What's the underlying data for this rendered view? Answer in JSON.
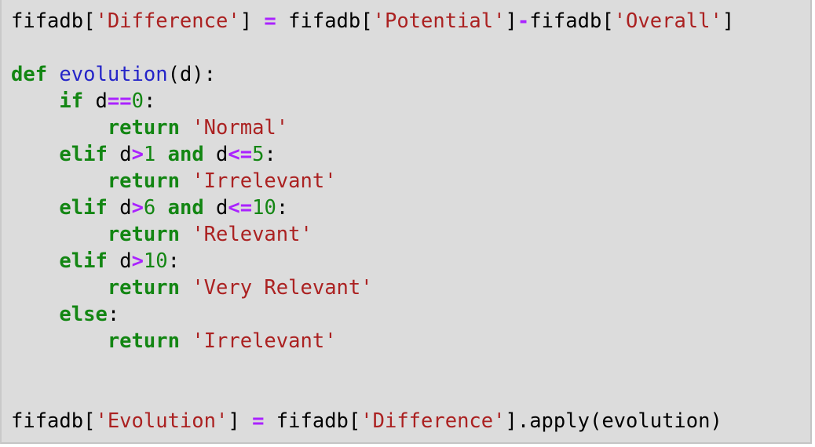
{
  "cell": {
    "lines": [
      {
        "tokens": [
          {
            "t": "fifadb[",
            "c": "pl"
          },
          {
            "t": "'Difference'",
            "c": "str"
          },
          {
            "t": "] ",
            "c": "pl"
          },
          {
            "t": "=",
            "c": "op"
          },
          {
            "t": " fifadb[",
            "c": "pl"
          },
          {
            "t": "'Potential'",
            "c": "str"
          },
          {
            "t": "]",
            "c": "pl"
          },
          {
            "t": "-",
            "c": "op"
          },
          {
            "t": "fifadb[",
            "c": "pl"
          },
          {
            "t": "'Overall'",
            "c": "str"
          },
          {
            "t": "]",
            "c": "pl"
          }
        ]
      },
      {
        "tokens": []
      },
      {
        "tokens": [
          {
            "t": "def",
            "c": "kw"
          },
          {
            "t": " ",
            "c": "pl"
          },
          {
            "t": "evolution",
            "c": "fn"
          },
          {
            "t": "(d):",
            "c": "pl"
          }
        ]
      },
      {
        "tokens": [
          {
            "t": "    ",
            "c": "pl"
          },
          {
            "t": "if",
            "c": "kw"
          },
          {
            "t": " d",
            "c": "pl"
          },
          {
            "t": "==",
            "c": "op"
          },
          {
            "t": "0",
            "c": "num"
          },
          {
            "t": ":",
            "c": "pl"
          }
        ]
      },
      {
        "tokens": [
          {
            "t": "        ",
            "c": "pl"
          },
          {
            "t": "return",
            "c": "kw"
          },
          {
            "t": " ",
            "c": "pl"
          },
          {
            "t": "'Normal'",
            "c": "str"
          }
        ]
      },
      {
        "tokens": [
          {
            "t": "    ",
            "c": "pl"
          },
          {
            "t": "elif",
            "c": "kw"
          },
          {
            "t": " d",
            "c": "pl"
          },
          {
            "t": ">",
            "c": "op"
          },
          {
            "t": "1",
            "c": "num"
          },
          {
            "t": " ",
            "c": "pl"
          },
          {
            "t": "and",
            "c": "kw"
          },
          {
            "t": " d",
            "c": "pl"
          },
          {
            "t": "<=",
            "c": "op"
          },
          {
            "t": "5",
            "c": "num"
          },
          {
            "t": ":",
            "c": "pl"
          }
        ]
      },
      {
        "tokens": [
          {
            "t": "        ",
            "c": "pl"
          },
          {
            "t": "return",
            "c": "kw"
          },
          {
            "t": " ",
            "c": "pl"
          },
          {
            "t": "'Irrelevant'",
            "c": "str"
          }
        ]
      },
      {
        "tokens": [
          {
            "t": "    ",
            "c": "pl"
          },
          {
            "t": "elif",
            "c": "kw"
          },
          {
            "t": " d",
            "c": "pl"
          },
          {
            "t": ">",
            "c": "op"
          },
          {
            "t": "6",
            "c": "num"
          },
          {
            "t": " ",
            "c": "pl"
          },
          {
            "t": "and",
            "c": "kw"
          },
          {
            "t": " d",
            "c": "pl"
          },
          {
            "t": "<=",
            "c": "op"
          },
          {
            "t": "10",
            "c": "num"
          },
          {
            "t": ":",
            "c": "pl"
          }
        ]
      },
      {
        "tokens": [
          {
            "t": "        ",
            "c": "pl"
          },
          {
            "t": "return",
            "c": "kw"
          },
          {
            "t": " ",
            "c": "pl"
          },
          {
            "t": "'Relevant'",
            "c": "str"
          }
        ]
      },
      {
        "tokens": [
          {
            "t": "    ",
            "c": "pl"
          },
          {
            "t": "elif",
            "c": "kw"
          },
          {
            "t": " d",
            "c": "pl"
          },
          {
            "t": ">",
            "c": "op"
          },
          {
            "t": "10",
            "c": "num"
          },
          {
            "t": ":",
            "c": "pl"
          }
        ]
      },
      {
        "tokens": [
          {
            "t": "        ",
            "c": "pl"
          },
          {
            "t": "return",
            "c": "kw"
          },
          {
            "t": " ",
            "c": "pl"
          },
          {
            "t": "'Very Relevant'",
            "c": "str"
          }
        ]
      },
      {
        "tokens": [
          {
            "t": "    ",
            "c": "pl"
          },
          {
            "t": "else",
            "c": "kw"
          },
          {
            "t": ":",
            "c": "pl"
          }
        ]
      },
      {
        "tokens": [
          {
            "t": "        ",
            "c": "pl"
          },
          {
            "t": "return",
            "c": "kw"
          },
          {
            "t": " ",
            "c": "pl"
          },
          {
            "t": "'Irrelevant'",
            "c": "str"
          }
        ]
      },
      {
        "tokens": []
      },
      {
        "tokens": []
      },
      {
        "tokens": [
          {
            "t": "fifadb[",
            "c": "pl"
          },
          {
            "t": "'Evolution'",
            "c": "str"
          },
          {
            "t": "] ",
            "c": "pl"
          },
          {
            "t": "=",
            "c": "op"
          },
          {
            "t": " fifadb[",
            "c": "pl"
          },
          {
            "t": "'Difference'",
            "c": "str"
          },
          {
            "t": "].apply(evolution)",
            "c": "pl"
          }
        ]
      }
    ]
  },
  "colors": {
    "background": "#dcdcdc",
    "string": "#ab2121",
    "keyword": "#138613",
    "operator": "#aa22ff",
    "function_name": "#2424c8",
    "plain": "#000000"
  }
}
